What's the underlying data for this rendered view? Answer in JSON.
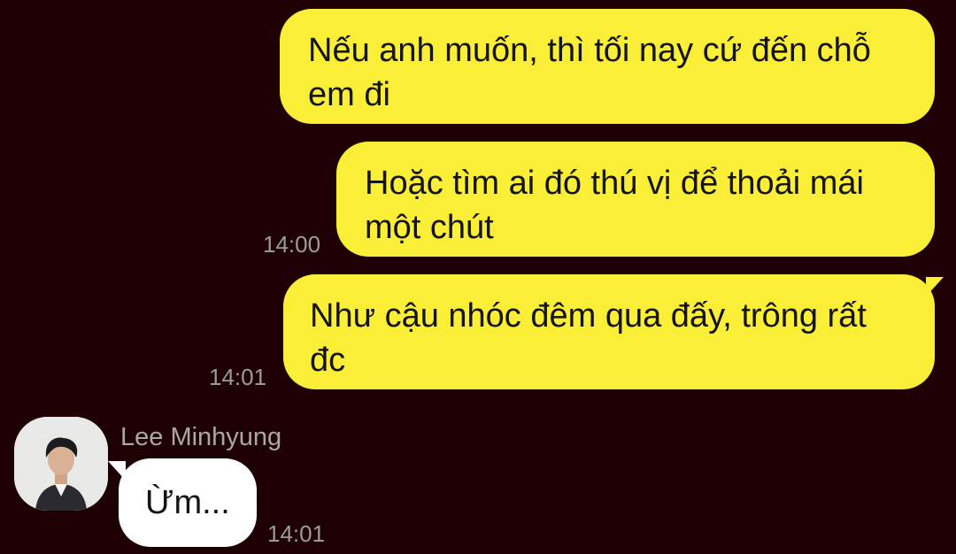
{
  "messages": [
    {
      "text": "Nếu anh muốn, thì tối nay cứ đến chỗ em đi",
      "time": ""
    },
    {
      "text": "Hoặc tìm ai đó thú vị để thoải mái một chút",
      "time": "14:00"
    },
    {
      "text": "Như cậu nhóc đêm qua đấy, trông rất đc",
      "time": "14:01"
    }
  ],
  "reply": {
    "sender": "Lee Minhyung",
    "text": "Ừm...",
    "time": "14:01",
    "avatar_icon": "user-avatar-icon"
  },
  "colors": {
    "background": "#1e0004",
    "outgoing_bubble": "#fbee37",
    "incoming_bubble": "#ffffff",
    "timestamp": "#9c9a9a"
  }
}
